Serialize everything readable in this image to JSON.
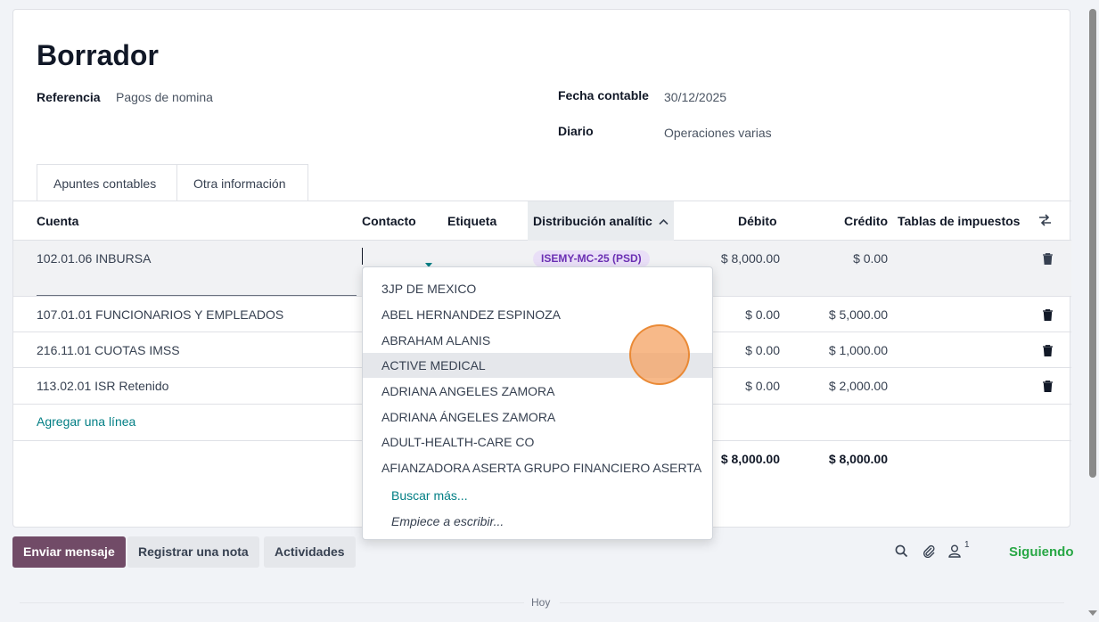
{
  "record": {
    "title": "Borrador",
    "reference_label": "Referencia",
    "reference_value": "Pagos de nomina",
    "date_label": "Fecha contable",
    "date_value": "30/12/2025",
    "journal_label": "Diario",
    "journal_value": "Operaciones varias"
  },
  "tabs": [
    {
      "label": "Apuntes contables",
      "active": true
    },
    {
      "label": "Otra información",
      "active": false
    }
  ],
  "table": {
    "headers": {
      "account": "Cuenta",
      "contact": "Contacto",
      "label": "Etiqueta",
      "analytic": "Distribución analític",
      "debit": "Débito",
      "credit": "Crédito",
      "taxes": "Tablas de impuestos"
    },
    "sort_icon": "chevron-up-icon",
    "rows": [
      {
        "account": "102.01.06 INBURSA",
        "analytic": "ISEMY-MC-25 (PSD)",
        "debit": "$ 8,000.00",
        "credit": "$ 0.00"
      },
      {
        "account": "107.01.01 FUNCIONARIOS Y EMPLEADOS",
        "debit": "$ 0.00",
        "credit": "$ 5,000.00"
      },
      {
        "account": "216.11.01 CUOTAS IMSS",
        "debit": "$ 0.00",
        "credit": "$ 1,000.00"
      },
      {
        "account": "113.02.01 ISR Retenido",
        "debit": "$ 0.00",
        "credit": "$ 2,000.00"
      }
    ],
    "add_line": "Agregar una línea",
    "total_debit": "$ 8,000.00",
    "total_credit": "$ 8,000.00"
  },
  "dropdown": {
    "items": [
      "3JP DE MEXICO",
      "ABEL HERNANDEZ ESPINOZA",
      "ABRAHAM ALANIS",
      "ACTIVE MEDICAL",
      "ADRIANA ANGELES ZAMORA",
      "ADRIANA ÁNGELES ZAMORA",
      "ADULT-HEALTH-CARE CO",
      "AFIANZADORA ASERTA GRUPO FINANCIERO ASERTA"
    ],
    "hovered": "ACTIVE MEDICAL",
    "search_more": "Buscar más...",
    "hint": "Empiece a escribir..."
  },
  "chatter": {
    "send_message": "Enviar mensaje",
    "log_note": "Registrar una nota",
    "activities": "Actividades",
    "followers_count": "1",
    "following": "Siguiendo",
    "today": "Hoy"
  },
  "colors": {
    "primary": "#714b67",
    "link": "#017e84",
    "badge_bg": "#e9dff7",
    "badge_text": "#6b2fb3",
    "following": "#28a745"
  }
}
